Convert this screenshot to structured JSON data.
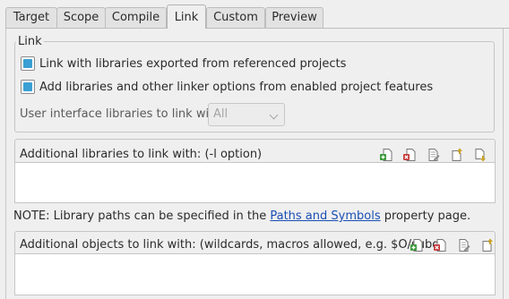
{
  "tabs": [
    {
      "label": "Target",
      "active": false
    },
    {
      "label": "Scope",
      "active": false
    },
    {
      "label": "Compile",
      "active": false
    },
    {
      "label": "Link",
      "active": true
    },
    {
      "label": "Custom",
      "active": false
    },
    {
      "label": "Preview",
      "active": false
    }
  ],
  "link_group": {
    "title": "Link",
    "checkboxes": [
      {
        "label": "Link with libraries exported from referenced projects",
        "checked": true
      },
      {
        "label": "Add libraries and other linker options from enabled project features",
        "checked": true
      }
    ],
    "ui_libraries_label": "User interface libraries to link with:",
    "ui_libraries_value": "All"
  },
  "libraries": {
    "header": "Additional libraries to link with: (-l option)",
    "toolbar_icons": [
      "add-item-icon",
      "delete-item-icon",
      "edit-item-icon",
      "move-up-icon",
      "move-down-icon"
    ]
  },
  "note": {
    "prefix": "NOTE: Library paths can be specified in the ",
    "link_text": "Paths and Symbols",
    "suffix": " property page."
  },
  "objects": {
    "header": "Additional objects to link with: (wildcards, macros allowed, e.g. $O/subdi",
    "toolbar_icons": [
      "add-item-icon",
      "delete-item-icon",
      "edit-item-icon",
      "move-up-icon"
    ]
  },
  "colors": {
    "checkbox_fill": "#3aa0d3",
    "link": "#1a4fb4",
    "background": "#efefef"
  }
}
